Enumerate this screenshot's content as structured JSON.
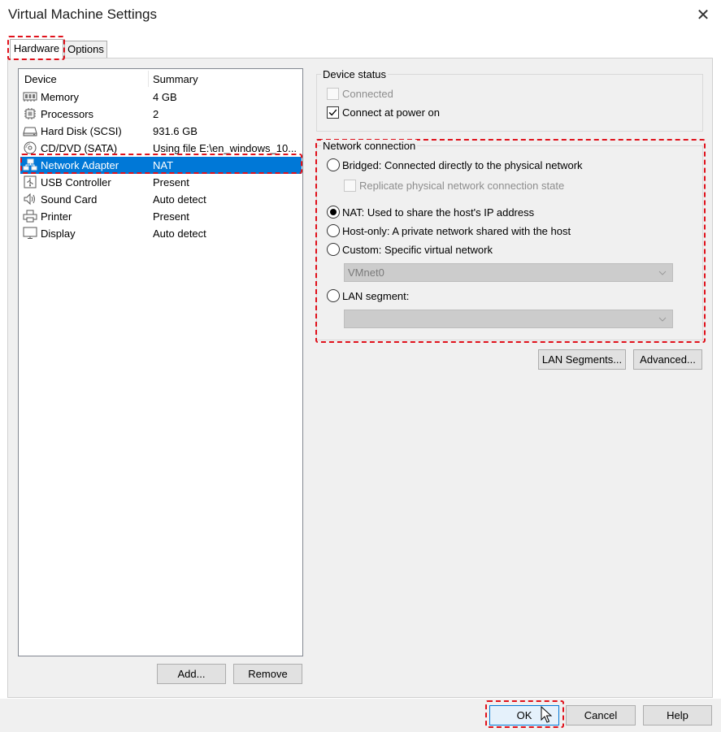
{
  "window": {
    "title": "Virtual Machine Settings",
    "close_glyph": "✕"
  },
  "tabs": [
    {
      "label": "Hardware",
      "active": true
    },
    {
      "label": "Options",
      "active": false
    }
  ],
  "device_list": {
    "columns": [
      "Device",
      "Summary"
    ],
    "rows": [
      {
        "icon": "memory-icon",
        "device": "Memory",
        "summary": "4 GB"
      },
      {
        "icon": "processor-icon",
        "device": "Processors",
        "summary": "2"
      },
      {
        "icon": "hard-disk-icon",
        "device": "Hard Disk (SCSI)",
        "summary": "931.6 GB"
      },
      {
        "icon": "cd-dvd-icon",
        "device": "CD/DVD (SATA)",
        "summary": "Using file E:\\en_windows_10..."
      },
      {
        "icon": "network-adapter-icon",
        "device": "Network Adapter",
        "summary": "NAT",
        "selected": true
      },
      {
        "icon": "usb-icon",
        "device": "USB Controller",
        "summary": "Present"
      },
      {
        "icon": "sound-icon",
        "device": "Sound Card",
        "summary": "Auto detect"
      },
      {
        "icon": "printer-icon",
        "device": "Printer",
        "summary": "Present"
      },
      {
        "icon": "display-icon",
        "device": "Display",
        "summary": "Auto detect"
      }
    ],
    "add_label": "Add...",
    "remove_label": "Remove"
  },
  "device_status": {
    "title": "Device status",
    "connected_label": "Connected",
    "connected_checked": false,
    "connected_enabled": false,
    "connect_at_power_on_label": "Connect at power on",
    "connect_at_power_on_checked": true
  },
  "network_connection": {
    "title": "Network connection",
    "bridged_label": "Bridged: Connected directly to the physical network",
    "replicate_label": "Replicate physical network connection state",
    "nat_label": "NAT: Used to share the host's IP address",
    "host_only_label": "Host-only: A private network shared with the host",
    "custom_label": "Custom: Specific virtual network",
    "custom_value": "VMnet0",
    "lan_segment_label": "LAN segment:",
    "lan_segment_value": "",
    "selected": "nat"
  },
  "side_buttons": {
    "lan_segments_label": "LAN Segments...",
    "advanced_label": "Advanced..."
  },
  "footer": {
    "ok_label": "OK",
    "cancel_label": "Cancel",
    "help_label": "Help"
  },
  "highlight_color": "#e0111b",
  "selection_color": "#0078d7"
}
